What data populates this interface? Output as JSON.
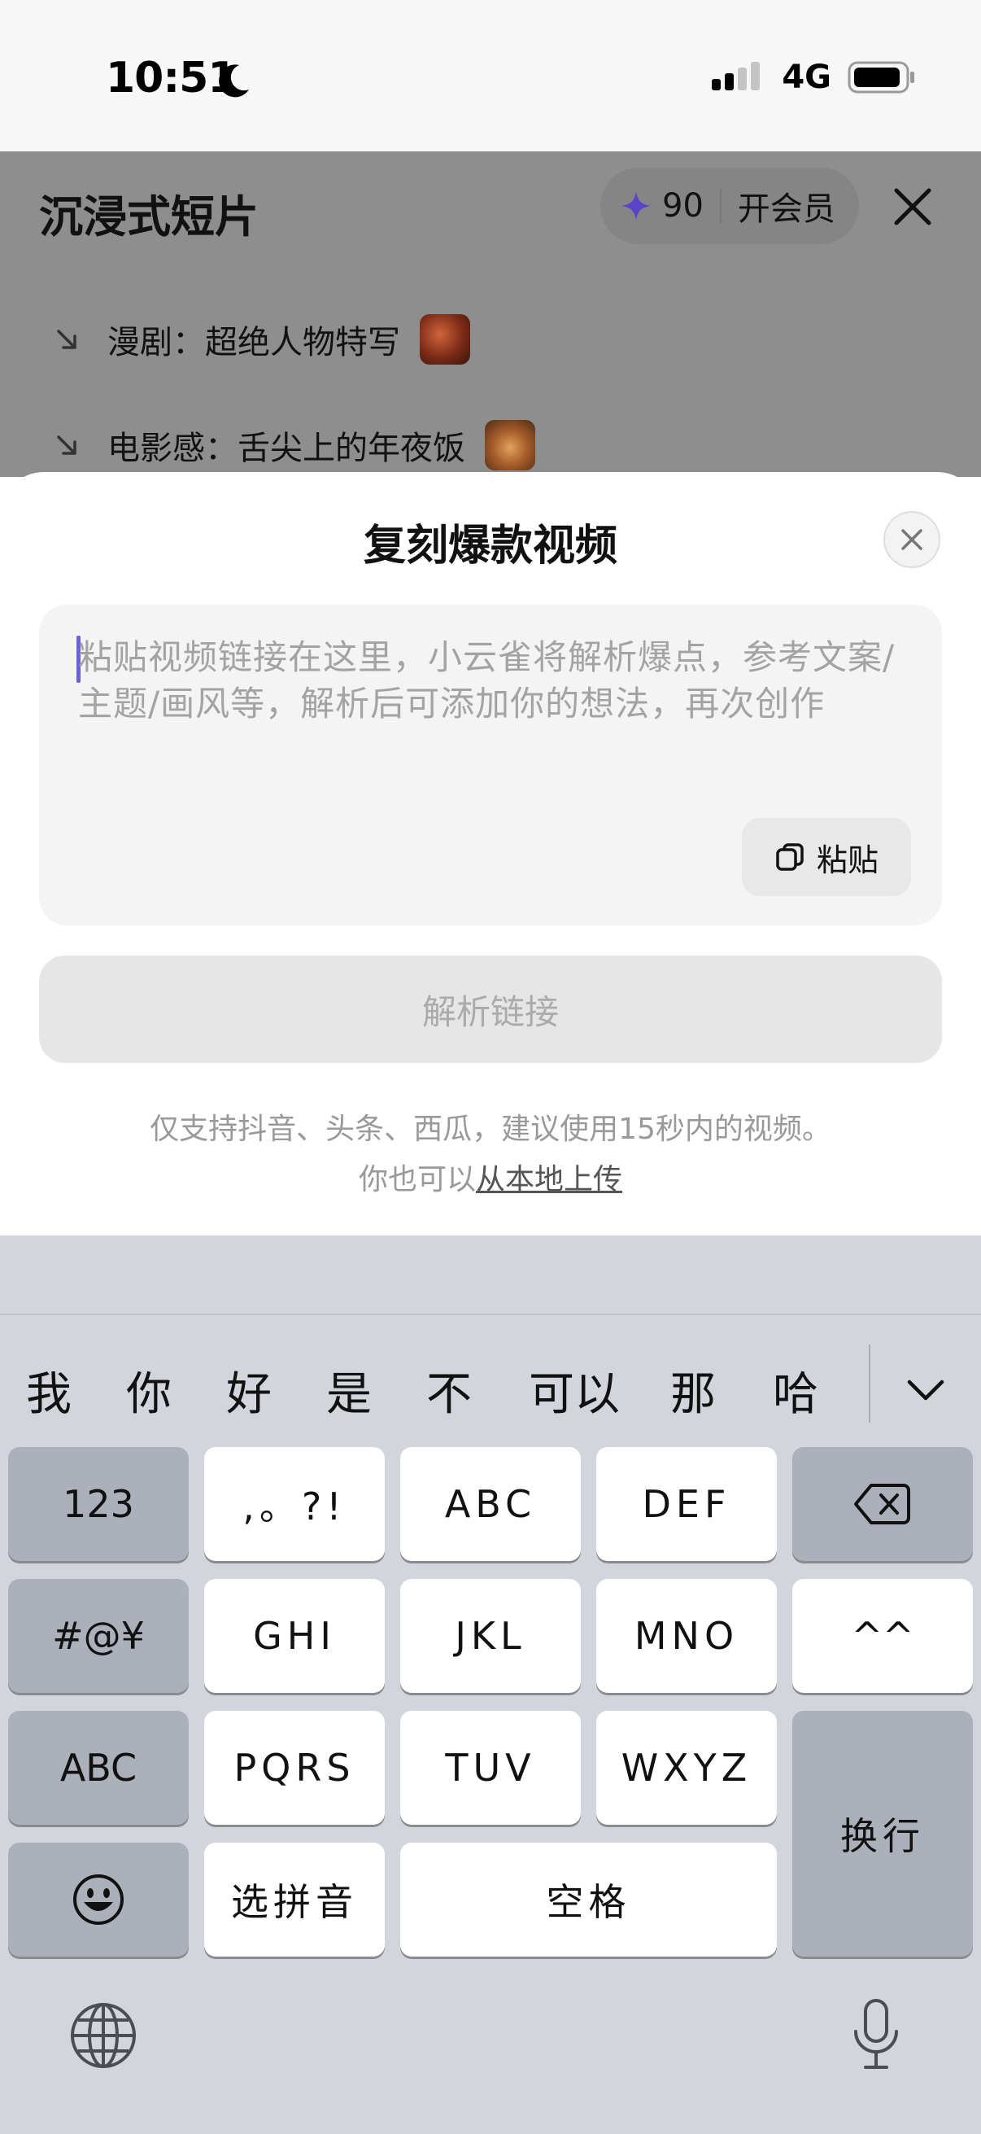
{
  "status_bar": {
    "time": "10:51",
    "network": "4G"
  },
  "background": {
    "title": "沉浸式短片",
    "points": "90",
    "vip_label": "开会员",
    "rows": [
      {
        "text": "漫剧：超绝人物特写"
      },
      {
        "text": "电影感：舌尖上的年夜饭"
      }
    ]
  },
  "sheet": {
    "title": "复刻爆款视频",
    "placeholder": "粘贴视频链接在这里，小云雀将解析爆点，参考文案/主题/画风等，解析后可添加你的想法，再次创作",
    "paste_label": "粘贴",
    "parse_label": "解析链接",
    "hint_line1": "仅支持抖音、头条、西瓜，建议使用15秒内的视频。",
    "hint_prefix": "你也可以",
    "hint_link": "从本地上传"
  },
  "keyboard": {
    "candidates": [
      "我",
      "你",
      "好",
      "是",
      "不",
      "可以",
      "那",
      "哈"
    ],
    "keys": {
      "num": "123",
      "punct": ",。?!",
      "abc": "ABC",
      "def": "DEF",
      "sym": "#@¥",
      "ghi": "GHI",
      "jkl": "JKL",
      "mno": "MNO",
      "face": "^^",
      "abc_mode": "ABC",
      "pqrs": "PQRS",
      "tuv": "TUV",
      "wxyz": "WXYZ",
      "return": "换行",
      "pinyin": "选拼音",
      "space": "空格"
    }
  },
  "colors": {
    "accent": "#6b62d6",
    "overlay": "#8e8e8e",
    "keyboard_bg": "#d2d5dc"
  },
  "icons": [
    "moon-icon",
    "signal-icon",
    "battery-icon",
    "sparkle-star-icon",
    "close-icon",
    "arrow-down-right-icon",
    "copy-icon",
    "chevron-down-icon",
    "backspace-icon",
    "emoji-icon",
    "globe-icon",
    "microphone-icon"
  ]
}
